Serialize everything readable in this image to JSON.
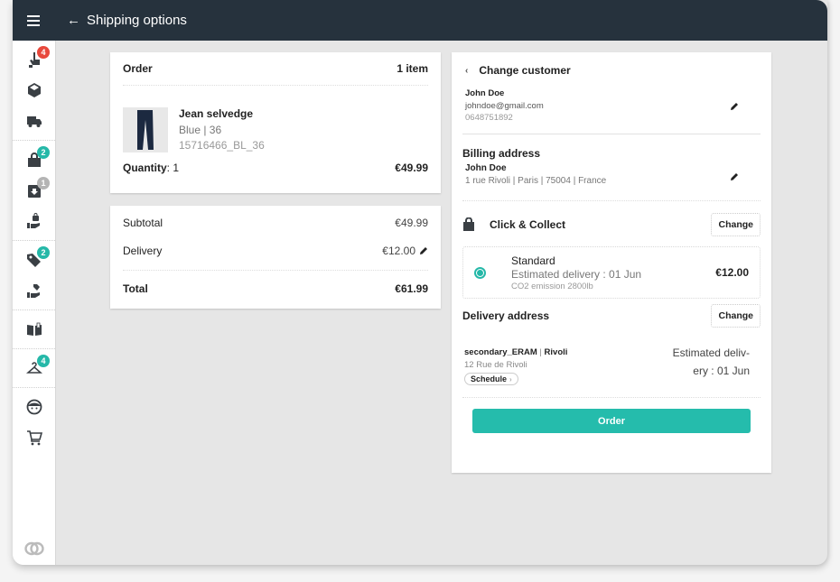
{
  "topbar": {
    "menu_icon": "hamburger-icon",
    "back_icon": "arrow-left-icon",
    "back_glyph": "←",
    "title": "Shipping options"
  },
  "sidebar": {
    "groups": [
      [
        {
          "icon": "hand-pointer-icon",
          "badge": "4",
          "badge_color": "#e8483c"
        },
        {
          "icon": "package-icon",
          "badge": null
        },
        {
          "icon": "truck-icon",
          "badge": null
        }
      ],
      [
        {
          "icon": "shopping-bag-icon",
          "badge": "2",
          "badge_color": "#25b8a8"
        },
        {
          "icon": "download-box-icon",
          "badge": "1",
          "badge_color": "#b4b4b4"
        },
        {
          "icon": "hand-bag-icon",
          "badge": null
        }
      ],
      [
        {
          "icon": "tags-icon",
          "badge": "2",
          "badge_color": "#25b8a8"
        },
        {
          "icon": "hand-tag-icon",
          "badge": null
        }
      ],
      [
        {
          "icon": "book-open-icon",
          "badge": null
        }
      ],
      [
        {
          "icon": "hanger-icon",
          "badge": "4",
          "badge_color": "#25b8a8"
        }
      ],
      [
        {
          "icon": "customer-face-icon",
          "badge": null
        },
        {
          "icon": "cart-icon",
          "badge": null
        }
      ]
    ],
    "logo_icon": "app-logo-icon"
  },
  "order": {
    "title": "Order",
    "count": "1 item",
    "product": {
      "name": "Jean selvedge",
      "variant": "Blue | 36",
      "sku": "15716466_BL_36",
      "image_icon": "jeans-thumbnail"
    },
    "quantity_label": "Quantity",
    "quantity_value": ": 1",
    "price": "€49.99"
  },
  "summary": {
    "subtotal_label": "Subtotal",
    "subtotal": "€49.99",
    "delivery_label": "Delivery",
    "delivery": "€12.00",
    "total_label": "Total",
    "total": "€61.99"
  },
  "customer": {
    "back_glyph": "‹",
    "change_label": "Change customer",
    "name": "John Doe",
    "email": "johndoe@gmail.com",
    "phone": "0648751892"
  },
  "billing": {
    "title": "Billing address",
    "name": "John Doe",
    "address": "1 rue Rivoli | Paris | 75004 | France"
  },
  "shipping": {
    "method": "Click & Collect",
    "change_label": "Change",
    "option": {
      "name": "Standard",
      "estimate": "Estimated delivery : 01 Jun",
      "co2": "CO2 emission 2800lb",
      "price": "€12.00",
      "selected": true
    },
    "accent": "#25b8a8"
  },
  "delivery_address": {
    "title": "Delivery address",
    "change_label": "Change",
    "store_name": "secondary_ERAM",
    "store_city": "Rivoli",
    "store_address": "12 Rue de Rivoli",
    "schedule_label": "Schedule",
    "estimate": "Estimated deliv-ery : 01 Jun"
  },
  "actions": {
    "order_label": "Order"
  }
}
